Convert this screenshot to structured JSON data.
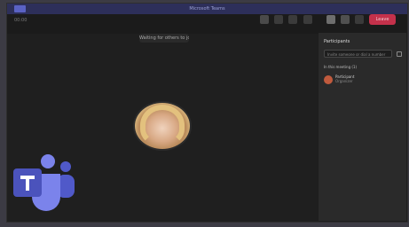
{
  "window": {
    "title": "Microsoft Teams"
  },
  "toolbar": {
    "timer": "00:00",
    "leave_label": "Leave"
  },
  "stage": {
    "status_text": "Waiting for others to join"
  },
  "participants_panel": {
    "title": "Participants",
    "invite_placeholder": "Invite someone or dial a number",
    "section_label": "In this meeting (1)",
    "people": [
      {
        "name": "Participant",
        "role": "Organizer"
      }
    ]
  },
  "colors": {
    "titlebar": "#2d2f5a",
    "leave": "#c4314b",
    "teams_brand": "#5059c9"
  },
  "icons": [
    "camera-icon",
    "chat-icon",
    "reactions-icon",
    "participants-icon",
    "more-icon",
    "mic-icon",
    "share-icon",
    "teams-logo"
  ]
}
